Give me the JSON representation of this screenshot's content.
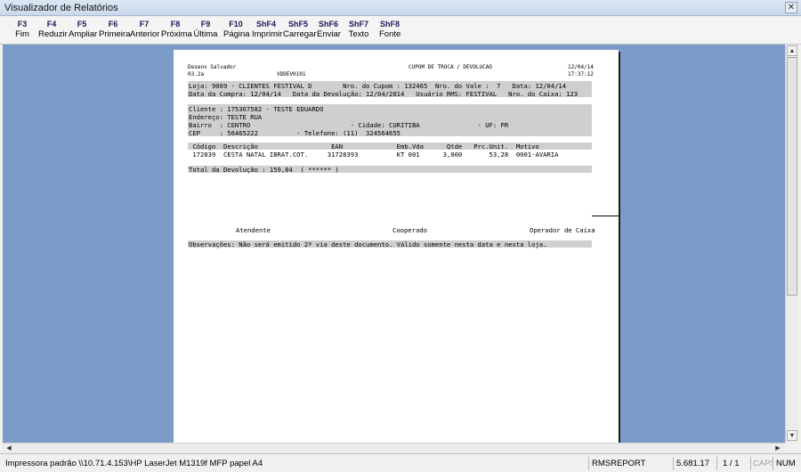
{
  "window": {
    "title": "Visualizador de Relatórios",
    "close_glyph": "✕"
  },
  "toolbar": [
    {
      "key": "F3",
      "label": "Fim",
      "name": "fim"
    },
    {
      "key": "F4",
      "label": "Reduzir",
      "name": "reduzir"
    },
    {
      "key": "F5",
      "label": "Ampliar",
      "name": "ampliar"
    },
    {
      "key": "F6",
      "label": "Primeira",
      "name": "primeira"
    },
    {
      "key": "F7",
      "label": "Anterior",
      "name": "anterior"
    },
    {
      "key": "F8",
      "label": "Próxima",
      "name": "proxima"
    },
    {
      "key": "F9",
      "label": "Última",
      "name": "ultima"
    },
    {
      "key": "F10",
      "label": "Página",
      "name": "pagina"
    },
    {
      "key": "ShF4",
      "label": "Imprimir",
      "name": "imprimir"
    },
    {
      "key": "ShF5",
      "label": "Carregar",
      "name": "carregar"
    },
    {
      "key": "ShF6",
      "label": "Enviar",
      "name": "enviar"
    },
    {
      "key": "ShF7",
      "label": "Texto",
      "name": "texto"
    },
    {
      "key": "ShF8",
      "label": "Fonte",
      "name": "fonte"
    }
  ],
  "report": {
    "header": {
      "left1": "Desenv Salvador",
      "left2": "03.2a",
      "program": "VDDEV0101",
      "title": "CUPOM DE TROCA / DEVOLUCAO",
      "date": "12/04/14",
      "time": "17:37:12"
    },
    "lines": {
      "loja": "Loja: 9069 - CLIENTES FESTIVAL D        Nro. do Cupom : 132465  Nro. do Vale :  7   Data: 12/04/14",
      "compra": "Data da Compra: 12/04/14   Data da Devolução: 12/04/2014   Usuário RMS: FESTIVAL   Nro. do Caixa: 123",
      "cliente": "Cliente : 175367582 - TESTE EDUARDO",
      "endereco": "Endereço: TESTE RUA",
      "bairro": "Bairro  : CENTRO                          - Cidade: CURITIBA               - UF: PR",
      "cep": "CEP     : 56465222          - Telefone: (11)  324564655",
      "itens_header": " Código  Descrição                   EAN              Emb.Vda      Qtde   Prc.Unit.  Motivo",
      "item_row": " 172839  CESTA NATAL IBRAT.COT.     31728393          KT 001      3,000       53,28  0001-AVARIA",
      "total": "Total da Devolução : 159,84  ( ****** )",
      "sig_atendente": "Atendente",
      "sig_cooperado": "Cooperado",
      "sig_operador": "Operador de Caixa",
      "observacoes": "Observações: Não será emitido 2ª via deste documento. Válido somente nesta data e nesta loja."
    }
  },
  "statusbar": {
    "printer": "Impressora padrão \\\\10.71.4.153\\HP LaserJet M1319f MFP papel A4",
    "report": "RMSREPORT",
    "version": "5.681.17",
    "pages": "1 / 1",
    "caps": "CAPS",
    "num": "NUM"
  },
  "colors": {
    "workspace": "#7b9cc9",
    "band": "#cfcfcf",
    "titlebar": "#c9d9ec"
  }
}
